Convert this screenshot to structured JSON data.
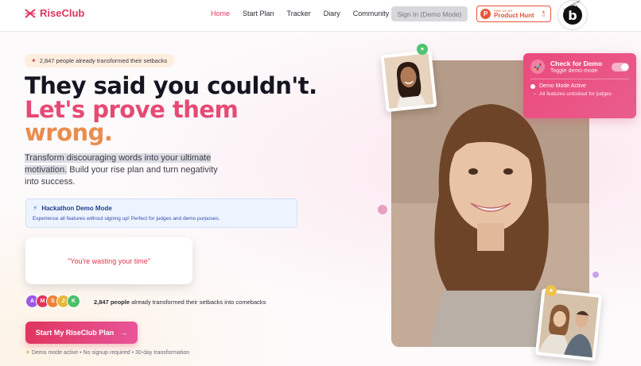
{
  "brand": {
    "name": "RiseClub"
  },
  "nav": {
    "items": [
      "Home",
      "Start Plan",
      "Tracker",
      "Diary",
      "Community"
    ],
    "active": "Home",
    "signin_label": "Sign In (Demo Mode)"
  },
  "product_hunt": {
    "small": "FIND US ON",
    "big": "Product Hunt",
    "count": "0"
  },
  "bolt_badge": {
    "letter": "b",
    "ring": "POWERED BY BOLT.NEW"
  },
  "hero": {
    "pill": "2,847 people already transformed their setbacks",
    "headline_1": "They said you couldn't.",
    "headline_2": "Let's prove them",
    "headline_3": "wrong.",
    "sub_highlight": "Transform discouraging words into your ultimate motivation.",
    "sub_rest": " Build your rise plan and turn negativity into success."
  },
  "demo_box": {
    "title": "Hackathon Demo Mode",
    "desc": "Experience all features without signing up! Perfect for judges and demo purposes."
  },
  "quote": "\"You're wasting your time\"",
  "avatars": {
    "letters": [
      "A",
      "M",
      "S",
      "J",
      "K"
    ],
    "colors": [
      "#9b59e6",
      "#e0355f",
      "#f0813c",
      "#e6b93a",
      "#4bbf6b"
    ],
    "count_bold": "2,847 people",
    "count_rest": " already transformed their setbacks into comebacks"
  },
  "cta": {
    "label": "Start My RiseClub Plan",
    "arrow": "→"
  },
  "footnote": "Demo mode active • No signup required • 30-day transformation",
  "check_panel": {
    "title": "Check for Demo",
    "subtitle": "Toggle demo mode",
    "status": "Demo Mode Active",
    "detail": "All features unlocked for judges"
  },
  "colors": {
    "brand": "#e0355f",
    "accent_orange": "#e88d4f",
    "demo_blue": "#eef4ff"
  },
  "icons": {
    "heart": "heart-icon",
    "star": "star-icon",
    "bolt": "bolt-icon",
    "rocket": "rocket-icon"
  }
}
